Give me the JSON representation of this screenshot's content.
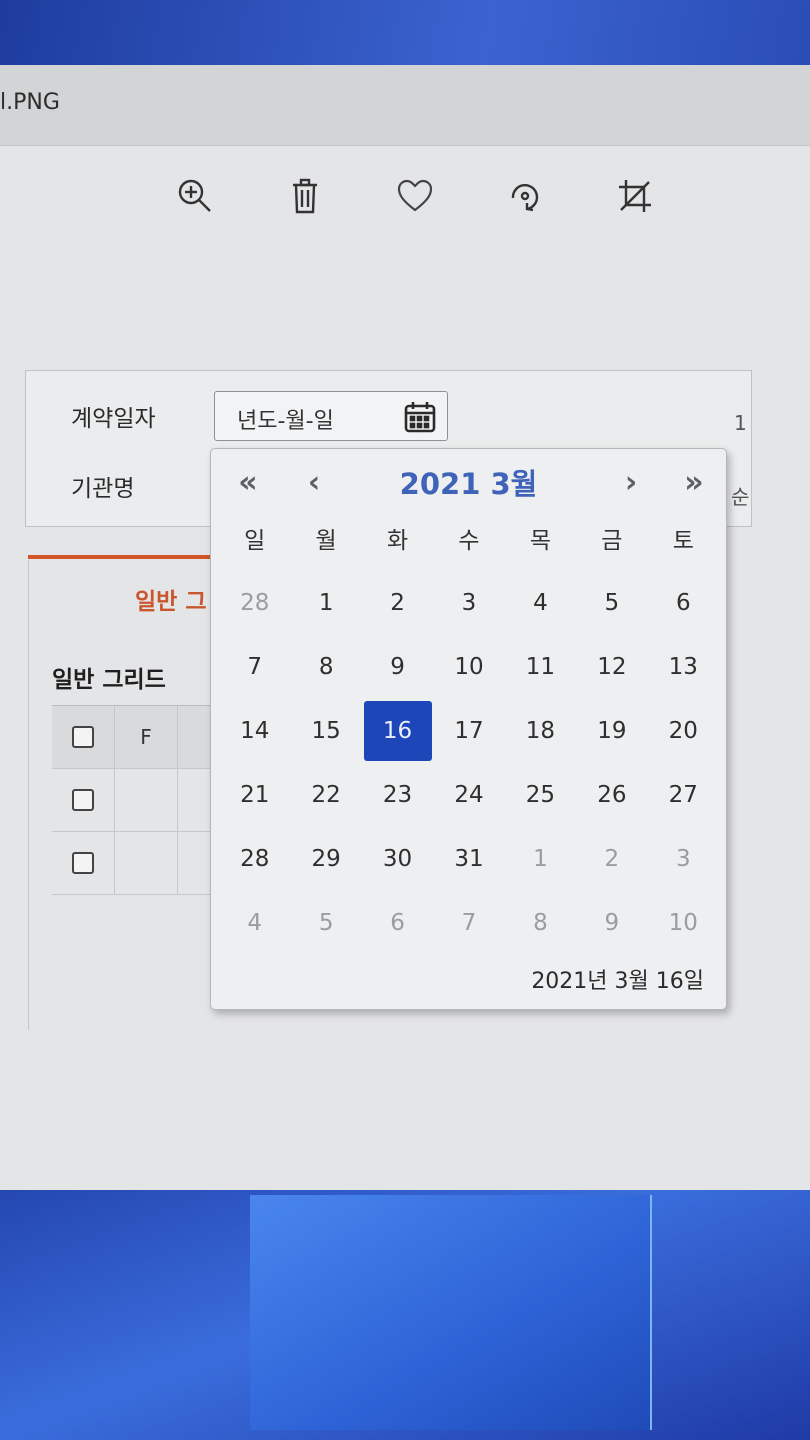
{
  "window": {
    "title": "l.PNG"
  },
  "toolbar": {
    "icons": [
      "zoom-in-icon",
      "delete-icon",
      "favorite-icon",
      "rotate-icon",
      "crop-icon"
    ]
  },
  "form": {
    "contract_date_label": "계약일자",
    "agency_label": "기관명",
    "date_placeholder": "년도-월-일",
    "right_mark_1": "1",
    "right_mark_2": "순"
  },
  "tabs": {
    "general_tab": "일반 그"
  },
  "grid": {
    "title": "일반 그리드",
    "header_col": "F",
    "rows": 2
  },
  "calendar": {
    "nav_prev_year": "«",
    "nav_prev_month": "‹",
    "nav_next_month": "›",
    "nav_next_year": "»",
    "title": "2021 3월",
    "weekdays": [
      "일",
      "월",
      "화",
      "수",
      "목",
      "금",
      "토"
    ],
    "days": [
      {
        "d": "28",
        "m": true
      },
      {
        "d": "1"
      },
      {
        "d": "2"
      },
      {
        "d": "3"
      },
      {
        "d": "4"
      },
      {
        "d": "5"
      },
      {
        "d": "6"
      },
      {
        "d": "7"
      },
      {
        "d": "8"
      },
      {
        "d": "9"
      },
      {
        "d": "10"
      },
      {
        "d": "11"
      },
      {
        "d": "12"
      },
      {
        "d": "13"
      },
      {
        "d": "14"
      },
      {
        "d": "15"
      },
      {
        "d": "16",
        "sel": true
      },
      {
        "d": "17"
      },
      {
        "d": "18"
      },
      {
        "d": "19"
      },
      {
        "d": "20"
      },
      {
        "d": "21"
      },
      {
        "d": "22"
      },
      {
        "d": "23"
      },
      {
        "d": "24"
      },
      {
        "d": "25"
      },
      {
        "d": "26"
      },
      {
        "d": "27"
      },
      {
        "d": "28"
      },
      {
        "d": "29"
      },
      {
        "d": "30"
      },
      {
        "d": "31"
      },
      {
        "d": "1",
        "m": true
      },
      {
        "d": "2",
        "m": true
      },
      {
        "d": "3",
        "m": true
      },
      {
        "d": "4",
        "m": true
      },
      {
        "d": "5",
        "m": true
      },
      {
        "d": "6",
        "m": true
      },
      {
        "d": "7",
        "m": true
      },
      {
        "d": "8",
        "m": true
      },
      {
        "d": "9",
        "m": true
      },
      {
        "d": "10",
        "m": true
      }
    ],
    "footer": "2021년 3월 16일",
    "selected_color": "#1d46b9",
    "title_color": "#3f63b8"
  }
}
